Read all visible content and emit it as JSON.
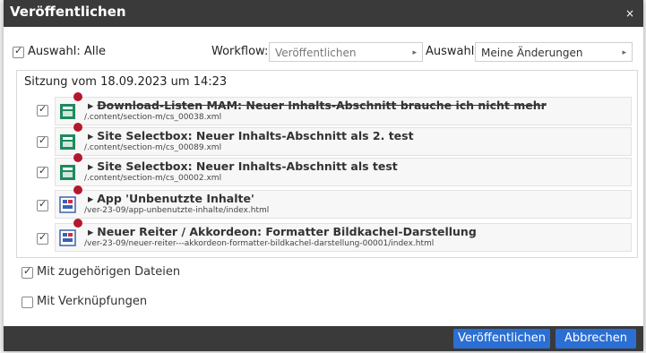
{
  "dialog": {
    "title": "Veröffentlichen",
    "close_label": "×"
  },
  "toolbar": {
    "select_all_label": "Auswahl: Alle",
    "select_all_checked": true,
    "workflow_label": "Workflow:",
    "workflow_placeholder": "Veröffentlichen",
    "selection_label": "Auswahl:",
    "selection_value": "Meine Änderungen"
  },
  "session": {
    "title": "Sitzung vom 18.09.2023 um 14:23",
    "items": [
      {
        "name": "Download-Listen MAM: Neuer Inhalts-Abschnitt brauche ich nicht mehr",
        "path": "/.content/section-m/cs_00038.xml",
        "checked": true,
        "deleted": true,
        "icon": "content-section-icon"
      },
      {
        "name": "Site Selectbox: Neuer Inhalts-Abschnitt als 2. test",
        "path": "/.content/section-m/cs_00089.xml",
        "checked": true,
        "deleted": false,
        "icon": "content-section-icon"
      },
      {
        "name": "Site Selectbox: Neuer Inhalts-Abschnitt als test",
        "path": "/.content/section-m/cs_00002.xml",
        "checked": true,
        "deleted": false,
        "icon": "content-section-icon"
      },
      {
        "name": "App 'Unbenutzte Inhalte'",
        "path": "/ver-23-09/app-unbenutzte-inhalte/index.html",
        "checked": true,
        "deleted": false,
        "icon": "container-page-icon"
      },
      {
        "name": "Neuer Reiter / Akkordeon: Formatter Bildkachel-Darstellung",
        "path": "/ver-23-09/neuer-reiter---akkordeon-formatter-bildkachel-darstellung-00001/index.html",
        "checked": true,
        "deleted": false,
        "icon": "container-page-icon"
      }
    ]
  },
  "options": {
    "related_files_label": "Mit zugehörigen Dateien",
    "related_files_checked": true,
    "links_label": "Mit Verknüpfungen",
    "links_checked": false
  },
  "footer": {
    "publish_label": "Veröffentlichen",
    "cancel_label": "Abbrechen"
  },
  "colors": {
    "titlebar": "#3a3a3a",
    "button": "#2b6fd4",
    "changed_dot": "#b3182c",
    "content_icon": "#1e8a5e",
    "page_icon": "#3a62b0"
  }
}
